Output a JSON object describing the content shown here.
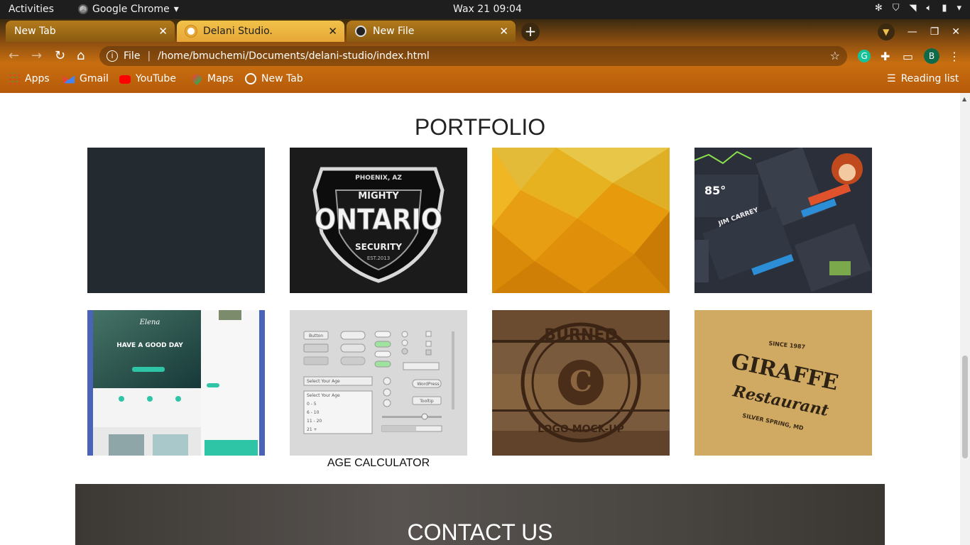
{
  "system_bar": {
    "activities": "Activities",
    "app_name": "Google Chrome",
    "clock": "Wax 21  09:04"
  },
  "browser": {
    "tabs": [
      {
        "label": "New Tab",
        "active": false
      },
      {
        "label": "Delani Studio.",
        "active": true
      },
      {
        "label": "New File",
        "active": false
      }
    ],
    "address_scheme": "File",
    "address_url": "/home/bmuchemi/Documents/delani-studio/index.html",
    "profile_initial": "B",
    "bookmarks": [
      "Apps",
      "Gmail",
      "YouTube",
      "Maps",
      "New Tab"
    ],
    "reading_list": "Reading list"
  },
  "page": {
    "portfolio_title": "PORTFOLIO",
    "tiles": [
      {
        "name": "work-dark-blank"
      },
      {
        "name": "work-mighty-ontario",
        "texts": [
          "PHOENIX, AZ",
          "MIGHTY",
          "ONTARIO",
          "SECURITY",
          "EST.2013"
        ]
      },
      {
        "name": "work-yellow-lowpoly"
      },
      {
        "name": "work-ui-dashboard",
        "texts": [
          "85°",
          "JIM CARREY"
        ]
      },
      {
        "name": "work-elena-website",
        "texts": [
          "Elena",
          "HAVE A GOOD DAY"
        ]
      },
      {
        "name": "work-ui-kit",
        "texts": [
          "Button",
          "Select Your Age",
          "0 - 5",
          "6 - 10",
          "11 - 20",
          "21 +",
          "WordPress",
          "Tooltip"
        ]
      },
      {
        "name": "work-burned-logo",
        "texts": [
          "BURNED",
          "LOGO MOCK-UP",
          "C"
        ]
      },
      {
        "name": "work-giraffe-restaurant",
        "texts": [
          "SINCE 1987",
          "GIRAFFE",
          "Restaurant",
          "SILVER SPRING, MD"
        ]
      }
    ],
    "age_calculator_caption": "AGE CALCULATOR",
    "contact_title": "CONTACT US"
  },
  "colors": {
    "tab_active": "#f1c24a",
    "frame": "#c96f10",
    "tile_dark": "#232b30"
  }
}
